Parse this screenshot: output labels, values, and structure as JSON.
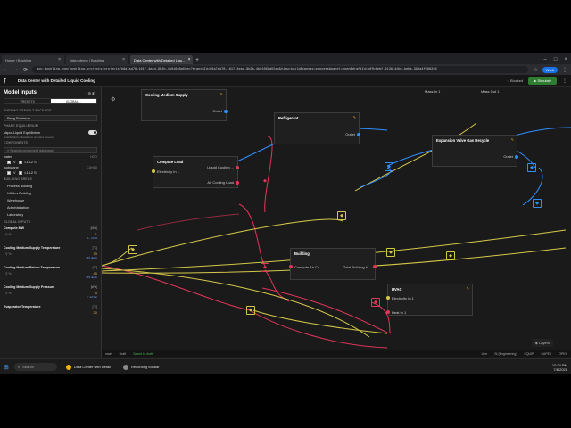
{
  "browser": {
    "tabs": [
      {
        "label": "Home | Boshling",
        "active": false
      },
      {
        "label": "video demo | Boshling",
        "active": false
      },
      {
        "label": "Data Center with Detailed Liqu...",
        "active": true
      }
    ],
    "url": "app.boshling.com/boshling-projects/projects/b6a7ad78-1617-4ead-9b2b-4b01668a55ec?branchId=b6a7ad78-1617-4ead-9b2b-4b01668a55ec&view=build&canvas=process&panel=open&draftId=b0fbfebf-6136-4dbe-beba-39da4f0962d6",
    "profile": "Work"
  },
  "app": {
    "project_title": "Data Center with Detailed Liquid Cooling",
    "blocked_label": "Blocked",
    "simulate_label": "Simulate"
  },
  "sidebar": {
    "title": "Model inputs",
    "seg_left": "PRESETS",
    "seg_right": "GLOBAL...",
    "thermo_label": "THERMO DEFAULT PACKAGE",
    "thermo_value": "Peng-Robinson",
    "phase_label": "PHASE EQUILIBRIUM",
    "vle_label": "Vapor-Liquid Equilibrium",
    "vle_hint": "Enable flash calculations on mass streams",
    "components_label": "COMPONENTS",
    "components_placeholder": "Search component database",
    "components": [
      {
        "name": "water",
        "formula": "H2O"
      },
      {
        "name": "Isobutane",
        "formula": "C4H10"
      }
    ],
    "building_label": "BUILDING AREAS",
    "areas": [
      "Process Building",
      "Utilities Building",
      "Warehouse",
      "Administration",
      "Laboratory"
    ],
    "global_label": "GLOBAL INPUTS",
    "inputs": [
      {
        "name": "Compute MW",
        "unit": "[MW]",
        "value": "1",
        "range": "1...10 %"
      },
      {
        "name": "Cooling Medium Supply Temperature",
        "unit": "[°C]",
        "value": "35",
        "range": "↑ 45 degC"
      },
      {
        "name": "Cooling Medium Return Temperature",
        "unit": "[°C]",
        "value": "45",
        "range": "↑ 55 degC"
      },
      {
        "name": "Cooling Medium Supply Pressure",
        "unit": "[kPa]",
        "value": "5",
        "range": "↑ 12 bar"
      },
      {
        "name": "Evaporator Temperature",
        "unit": "[°C]",
        "value": "20",
        "range": ""
      }
    ]
  },
  "nodes": {
    "cooling_supply": {
      "title": "Cooling Medium Supply",
      "port": "Outlet"
    },
    "refrigerant": {
      "title": "Refrigerant",
      "port": "Outlet"
    },
    "expansion": {
      "title": "Expansion Valve Gas Recycle",
      "port": "Outlet"
    },
    "compute_load": {
      "title": "Compute Load",
      "in": "Electricity In 1",
      "out1": "Liquid Cooling ...",
      "out2": "Air Cooling Load"
    },
    "building": {
      "title": "Building",
      "in": "Compute Air Co...",
      "out": "Total Building H..."
    },
    "hvac": {
      "title": "HVAC",
      "in1": "Electricity In 1",
      "out": "Heat In 1"
    },
    "top_labels": [
      "Mass In 1",
      "Mass Out 1"
    ]
  },
  "canvas": {
    "layers_label": "Layers"
  },
  "status": {
    "branch": "main",
    "draft": "Draft",
    "saved": "Saved to draft",
    "units": "SI (Engineering)",
    "items": [
      "Line",
      "EQUIP",
      "CAPEX",
      "OPEX"
    ]
  },
  "taskbar": {
    "search": "Search",
    "apps": [
      "Data Center with Detail",
      "Recording toolbar"
    ],
    "time": "10:24 PM",
    "date": "7/8/2026"
  },
  "colors": {
    "accent_green": "#2e7d32",
    "edge_red": "#e2365b",
    "edge_yellow": "#d4c84a",
    "edge_blue": "#2f8fff"
  }
}
